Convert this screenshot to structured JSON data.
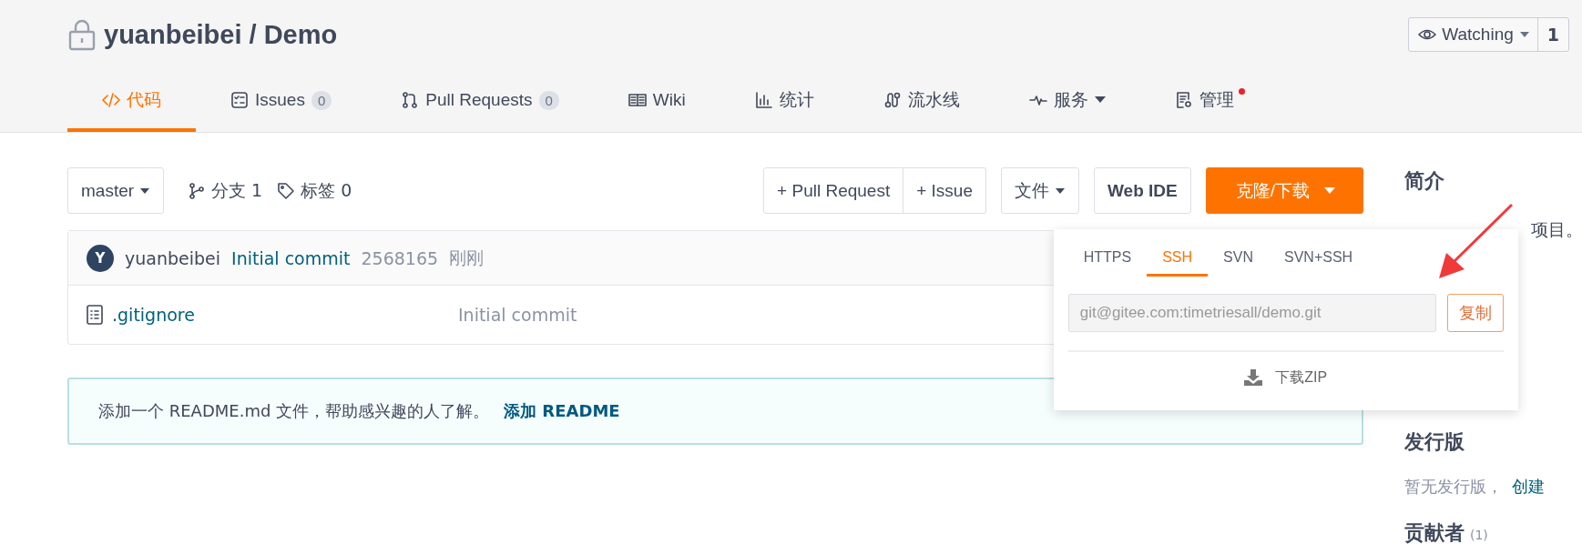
{
  "repo": {
    "private": true,
    "owner": "yuanbeibei",
    "separator": "/",
    "name": "Demo"
  },
  "watch": {
    "label": "Watching",
    "count": "1"
  },
  "tabs": [
    {
      "kind": "code",
      "label": "代码",
      "selected": true
    },
    {
      "kind": "issues",
      "label": "Issues",
      "count": "0",
      "selected": false
    },
    {
      "kind": "pulls",
      "label": "Pull Requests",
      "count": "0",
      "selected": false
    },
    {
      "kind": "wiki",
      "label": "Wiki",
      "selected": false
    },
    {
      "kind": "stats",
      "label": "统计",
      "selected": false
    },
    {
      "kind": "pipeline",
      "label": "流水线",
      "selected": false
    },
    {
      "kind": "services",
      "label": "服务",
      "dropdown": true,
      "selected": false
    },
    {
      "kind": "manage",
      "label": "管理",
      "notification": true,
      "selected": false
    }
  ],
  "toolbar": {
    "branch": "master",
    "branches": "分支 1",
    "tags": "标签 0",
    "actions": [
      "+ Pull Request",
      "+ Issue"
    ],
    "file_menu": "文件",
    "web_ide": "Web IDE",
    "clone": "克隆/下载"
  },
  "commit": {
    "avatar": "Y",
    "author": "yuanbeibei",
    "message": "Initial commit",
    "hash": "2568165",
    "time": "刚刚"
  },
  "files": [
    {
      "name": ".gitignore",
      "commit": "Initial commit"
    }
  ],
  "readme_notice": {
    "text": "添加一个 README.md 文件，帮助感兴趣的人了解。",
    "link": "添加 README"
  },
  "clone_menu": {
    "protocols": [
      {
        "label": "HTTPS",
        "selected": false
      },
      {
        "label": "SSH",
        "selected": true
      },
      {
        "label": "SVN",
        "selected": false
      },
      {
        "label": "SVN+SSH",
        "selected": false
      }
    ],
    "url": "git@gitee.com:timetriesall/demo.git",
    "copy": "复制",
    "download": "下载ZIP"
  },
  "sidebar": {
    "intro_title": "简介",
    "intro_text": "项目。",
    "releases_title": "发行版",
    "releases_text": "暂无发行版，",
    "releases_link": "创建",
    "contributors_title": "贡献者",
    "contributors_count": "(1)"
  }
}
